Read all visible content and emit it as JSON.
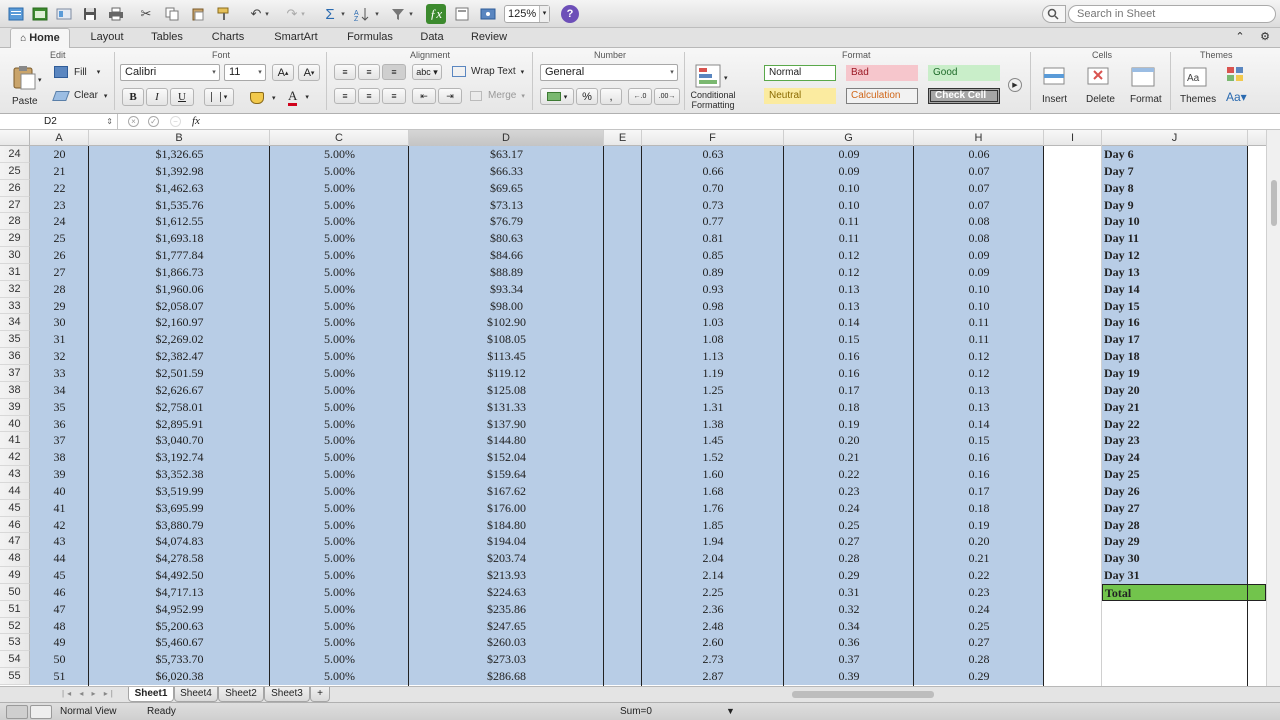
{
  "toolbar": {
    "zoom": "125%",
    "search_placeholder": "Search in Sheet"
  },
  "ribbon_tabs": [
    "Home",
    "Layout",
    "Tables",
    "Charts",
    "SmartArt",
    "Formulas",
    "Data",
    "Review"
  ],
  "ribbon": {
    "groups": {
      "edit": "Edit",
      "font": "Font",
      "alignment": "Alignment",
      "number": "Number",
      "format": "Format",
      "cells": "Cells",
      "themes": "Themes"
    },
    "paste": "Paste",
    "fill": "Fill",
    "clear": "Clear",
    "font_name": "Calibri",
    "font_size": "11",
    "bold": "B",
    "italic": "I",
    "underline": "U",
    "wrap_text": "Wrap Text",
    "merge": "Merge",
    "number_format": "General",
    "percent": "%",
    "comma": ",",
    "conditional_formatting_line1": "Conditional",
    "conditional_formatting_line2": "Formatting",
    "styles": {
      "normal": "Normal",
      "bad": "Bad",
      "good": "Good",
      "neutral": "Neutral",
      "calculation": "Calculation",
      "check_cell": "Check Cell"
    },
    "insert": "Insert",
    "delete": "Delete",
    "format_btn": "Format",
    "themes_btn": "Themes"
  },
  "formula_bar": {
    "cell_ref": "D2",
    "fx": "fx",
    "formula": ""
  },
  "columns": [
    "A",
    "B",
    "C",
    "D",
    "E",
    "F",
    "G",
    "H",
    "I",
    "J"
  ],
  "rows": [
    {
      "n": "24",
      "a": "20",
      "b": "$1,326.65",
      "c": "5.00%",
      "d": "$63.17",
      "f": "0.63",
      "g": "0.09",
      "h": "0.06",
      "j": "Day 6"
    },
    {
      "n": "25",
      "a": "21",
      "b": "$1,392.98",
      "c": "5.00%",
      "d": "$66.33",
      "f": "0.66",
      "g": "0.09",
      "h": "0.07",
      "j": "Day 7"
    },
    {
      "n": "26",
      "a": "22",
      "b": "$1,462.63",
      "c": "5.00%",
      "d": "$69.65",
      "f": "0.70",
      "g": "0.10",
      "h": "0.07",
      "j": "Day 8"
    },
    {
      "n": "27",
      "a": "23",
      "b": "$1,535.76",
      "c": "5.00%",
      "d": "$73.13",
      "f": "0.73",
      "g": "0.10",
      "h": "0.07",
      "j": "Day 9"
    },
    {
      "n": "28",
      "a": "24",
      "b": "$1,612.55",
      "c": "5.00%",
      "d": "$76.79",
      "f": "0.77",
      "g": "0.11",
      "h": "0.08",
      "j": "Day 10"
    },
    {
      "n": "29",
      "a": "25",
      "b": "$1,693.18",
      "c": "5.00%",
      "d": "$80.63",
      "f": "0.81",
      "g": "0.11",
      "h": "0.08",
      "j": "Day 11"
    },
    {
      "n": "30",
      "a": "26",
      "b": "$1,777.84",
      "c": "5.00%",
      "d": "$84.66",
      "f": "0.85",
      "g": "0.12",
      "h": "0.09",
      "j": "Day 12"
    },
    {
      "n": "31",
      "a": "27",
      "b": "$1,866.73",
      "c": "5.00%",
      "d": "$88.89",
      "f": "0.89",
      "g": "0.12",
      "h": "0.09",
      "j": "Day 13"
    },
    {
      "n": "32",
      "a": "28",
      "b": "$1,960.06",
      "c": "5.00%",
      "d": "$93.34",
      "f": "0.93",
      "g": "0.13",
      "h": "0.10",
      "j": "Day 14"
    },
    {
      "n": "33",
      "a": "29",
      "b": "$2,058.07",
      "c": "5.00%",
      "d": "$98.00",
      "f": "0.98",
      "g": "0.13",
      "h": "0.10",
      "j": "Day 15"
    },
    {
      "n": "34",
      "a": "30",
      "b": "$2,160.97",
      "c": "5.00%",
      "d": "$102.90",
      "f": "1.03",
      "g": "0.14",
      "h": "0.11",
      "j": "Day 16"
    },
    {
      "n": "35",
      "a": "31",
      "b": "$2,269.02",
      "c": "5.00%",
      "d": "$108.05",
      "f": "1.08",
      "g": "0.15",
      "h": "0.11",
      "j": "Day 17"
    },
    {
      "n": "36",
      "a": "32",
      "b": "$2,382.47",
      "c": "5.00%",
      "d": "$113.45",
      "f": "1.13",
      "g": "0.16",
      "h": "0.12",
      "j": "Day 18"
    },
    {
      "n": "37",
      "a": "33",
      "b": "$2,501.59",
      "c": "5.00%",
      "d": "$119.12",
      "f": "1.19",
      "g": "0.16",
      "h": "0.12",
      "j": "Day 19"
    },
    {
      "n": "38",
      "a": "34",
      "b": "$2,626.67",
      "c": "5.00%",
      "d": "$125.08",
      "f": "1.25",
      "g": "0.17",
      "h": "0.13",
      "j": "Day 20"
    },
    {
      "n": "39",
      "a": "35",
      "b": "$2,758.01",
      "c": "5.00%",
      "d": "$131.33",
      "f": "1.31",
      "g": "0.18",
      "h": "0.13",
      "j": "Day 21"
    },
    {
      "n": "40",
      "a": "36",
      "b": "$2,895.91",
      "c": "5.00%",
      "d": "$137.90",
      "f": "1.38",
      "g": "0.19",
      "h": "0.14",
      "j": "Day 22"
    },
    {
      "n": "41",
      "a": "37",
      "b": "$3,040.70",
      "c": "5.00%",
      "d": "$144.80",
      "f": "1.45",
      "g": "0.20",
      "h": "0.15",
      "j": "Day 23"
    },
    {
      "n": "42",
      "a": "38",
      "b": "$3,192.74",
      "c": "5.00%",
      "d": "$152.04",
      "f": "1.52",
      "g": "0.21",
      "h": "0.16",
      "j": "Day 24"
    },
    {
      "n": "43",
      "a": "39",
      "b": "$3,352.38",
      "c": "5.00%",
      "d": "$159.64",
      "f": "1.60",
      "g": "0.22",
      "h": "0.16",
      "j": "Day 25"
    },
    {
      "n": "44",
      "a": "40",
      "b": "$3,519.99",
      "c": "5.00%",
      "d": "$167.62",
      "f": "1.68",
      "g": "0.23",
      "h": "0.17",
      "j": "Day 26"
    },
    {
      "n": "45",
      "a": "41",
      "b": "$3,695.99",
      "c": "5.00%",
      "d": "$176.00",
      "f": "1.76",
      "g": "0.24",
      "h": "0.18",
      "j": "Day 27"
    },
    {
      "n": "46",
      "a": "42",
      "b": "$3,880.79",
      "c": "5.00%",
      "d": "$184.80",
      "f": "1.85",
      "g": "0.25",
      "h": "0.19",
      "j": "Day 28"
    },
    {
      "n": "47",
      "a": "43",
      "b": "$4,074.83",
      "c": "5.00%",
      "d": "$194.04",
      "f": "1.94",
      "g": "0.27",
      "h": "0.20",
      "j": "Day 29"
    },
    {
      "n": "48",
      "a": "44",
      "b": "$4,278.58",
      "c": "5.00%",
      "d": "$203.74",
      "f": "2.04",
      "g": "0.28",
      "h": "0.21",
      "j": "Day 30"
    },
    {
      "n": "49",
      "a": "45",
      "b": "$4,492.50",
      "c": "5.00%",
      "d": "$213.93",
      "f": "2.14",
      "g": "0.29",
      "h": "0.22",
      "j": "Day 31"
    },
    {
      "n": "50",
      "a": "46",
      "b": "$4,717.13",
      "c": "5.00%",
      "d": "$224.63",
      "f": "2.25",
      "g": "0.31",
      "h": "0.23",
      "j": "Total"
    },
    {
      "n": "51",
      "a": "47",
      "b": "$4,952.99",
      "c": "5.00%",
      "d": "$235.86",
      "f": "2.36",
      "g": "0.32",
      "h": "0.24",
      "j": ""
    },
    {
      "n": "52",
      "a": "48",
      "b": "$5,200.63",
      "c": "5.00%",
      "d": "$247.65",
      "f": "2.48",
      "g": "0.34",
      "h": "0.25",
      "j": ""
    },
    {
      "n": "53",
      "a": "49",
      "b": "$5,460.67",
      "c": "5.00%",
      "d": "$260.03",
      "f": "2.60",
      "g": "0.36",
      "h": "0.27",
      "j": ""
    },
    {
      "n": "54",
      "a": "50",
      "b": "$5,733.70",
      "c": "5.00%",
      "d": "$273.03",
      "f": "2.73",
      "g": "0.37",
      "h": "0.28",
      "j": ""
    },
    {
      "n": "55",
      "a": "51",
      "b": "$6,020.38",
      "c": "5.00%",
      "d": "$286.68",
      "f": "2.87",
      "g": "0.39",
      "h": "0.29",
      "j": ""
    }
  ],
  "sheet_tabs": [
    "Sheet1",
    "Sheet4",
    "Sheet2",
    "Sheet3"
  ],
  "active_sheet": "Sheet1",
  "add_sheet": "+",
  "status": {
    "view": "Normal View",
    "state": "Ready",
    "sum": "Sum=0"
  },
  "colors": {
    "selection": "#b8cde6",
    "total_fill": "#72c44c",
    "ribbon_active_icon": "#3c8a2e"
  }
}
